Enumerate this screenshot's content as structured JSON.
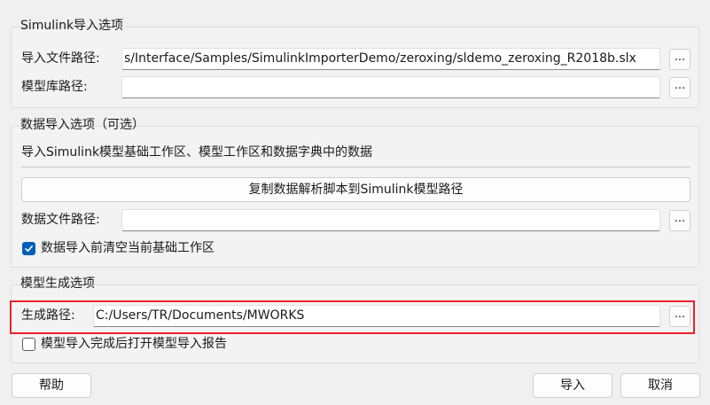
{
  "simulink_group": {
    "title": "Simulink导入选项",
    "import_path_label": "导入文件路径:",
    "import_path_value": "s/Interface/Samples/SimulinkImporterDemo/zeroxing/sldemo_zeroxing_R2018b.slx",
    "library_path_label": "模型库路径:",
    "library_path_value": "",
    "browse_label": "..."
  },
  "data_group": {
    "title": "数据导入选项（可选）",
    "description": "导入Simulink模型基础工作区、模型工作区和数据字典中的数据",
    "copy_script_button": "复制数据解析脚本到Simulink模型路径",
    "data_file_label": "数据文件路径:",
    "data_file_value": "",
    "browse_label": "...",
    "clear_workspace_label": "数据导入前清空当前基础工作区",
    "clear_workspace_checked": true
  },
  "generate_group": {
    "title": "模型生成选项",
    "output_path_label": "生成路径:",
    "output_path_value": "C:/Users/TR/Documents/MWORKS",
    "browse_label": "...",
    "open_report_label": "模型导入完成后打开模型导入报告",
    "open_report_checked": false
  },
  "footer": {
    "help_button": "帮助",
    "import_button": "导入",
    "cancel_button": "取消"
  },
  "colors": {
    "accent": "#005fb8",
    "highlight": "#e8232a"
  }
}
